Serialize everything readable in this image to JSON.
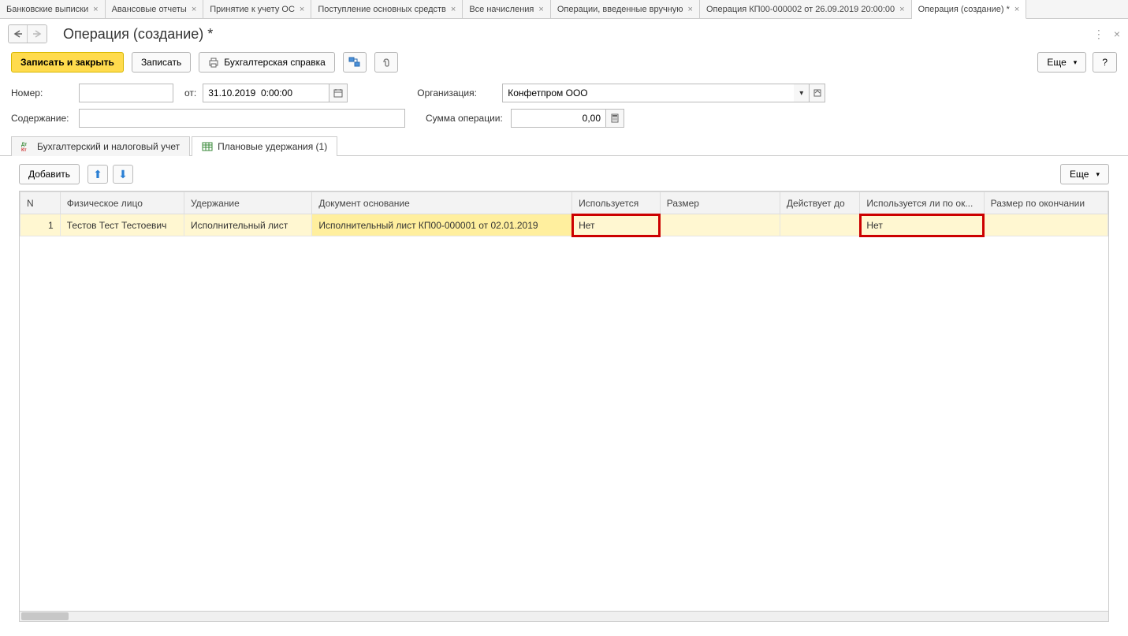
{
  "app_tabs": [
    {
      "label": "Банковские выписки",
      "active": false
    },
    {
      "label": "Авансовые отчеты",
      "active": false
    },
    {
      "label": "Принятие к учету ОС",
      "active": false
    },
    {
      "label": "Поступление основных средств",
      "active": false
    },
    {
      "label": "Все начисления",
      "active": false
    },
    {
      "label": "Операции, введенные вручную",
      "active": false
    },
    {
      "label": "Операция КП00-000002 от 26.09.2019 20:00:00",
      "active": false
    },
    {
      "label": "Операция (создание) *",
      "active": true
    }
  ],
  "page_title": "Операция (создание) *",
  "toolbar": {
    "save_close_label": "Записать и закрыть",
    "save_label": "Записать",
    "report_label": "Бухгалтерская справка",
    "more_label": "Еще",
    "help_label": "?"
  },
  "form": {
    "number_label": "Номер:",
    "number_value": "",
    "from_label": "от:",
    "date_value": "31.10.2019  0:00:00",
    "org_label": "Организация:",
    "org_value": "Конфетпром ООО",
    "content_label": "Содержание:",
    "content_value": "",
    "sum_label": "Сумма операции:",
    "sum_value": "0,00"
  },
  "section_tabs": {
    "accounting_label": "Бухгалтерский и налоговый учет",
    "planned_label": "Плановые удержания (1)"
  },
  "tbl_toolbar": {
    "add_label": "Добавить",
    "more_label": "Еще"
  },
  "table": {
    "headers": {
      "n": "N",
      "person": "Физическое лицо",
      "uder": "Удержание",
      "doc": "Документ основание",
      "used": "Используется",
      "size": "Размер",
      "until": "Действует до",
      "usedend": "Используется ли по ок...",
      "sizeend": "Размер по окончании"
    },
    "rows": [
      {
        "n": "1",
        "person": "Тестов Тест Тестоевич",
        "uder": "Исполнительный лист",
        "doc": "Исполнительный лист КП00-000001 от 02.01.2019",
        "used": "Нет",
        "size": "",
        "until": "",
        "usedend": "Нет",
        "sizeend": ""
      }
    ]
  }
}
